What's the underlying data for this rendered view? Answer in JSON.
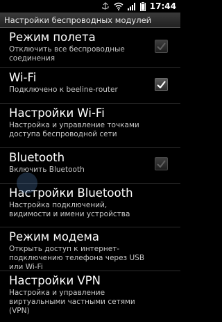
{
  "status_bar": {
    "time": "17:44",
    "icons": [
      "usb-debug-icon",
      "wifi-signal-icon",
      "cell-signal-icon",
      "battery-icon"
    ]
  },
  "header": {
    "title": "Настройки беспроводных модулей"
  },
  "settings": [
    {
      "title": "Режим полета",
      "subtitle": "Отключить все беспроводные соединения",
      "has_checkbox": true,
      "checked": false
    },
    {
      "title": "Wi-Fi",
      "subtitle": "Подключено к beeline-router",
      "has_checkbox": true,
      "checked": true
    },
    {
      "title": "Настройки Wi-Fi",
      "subtitle": "Настройка и управление точками доступа беспроводной сети",
      "has_checkbox": false
    },
    {
      "title": "Bluetooth",
      "subtitle": "Включить Bluetooth",
      "has_checkbox": true,
      "checked": false
    },
    {
      "title": "Настройки Bluetooth",
      "subtitle": "Настройка подключений, видимости и имени устройства",
      "has_checkbox": false
    },
    {
      "title": "Режим модема",
      "subtitle": "Открыть доступ к интернет-подключению телефона через USB или Wi-Fi",
      "has_checkbox": false
    },
    {
      "title": "Настройки VPN",
      "subtitle": "Настройка и управление виртуальными частными сетями (VPN)",
      "has_checkbox": false
    }
  ],
  "colors": {
    "background": "#000000",
    "checkmark": "#ffffff"
  }
}
